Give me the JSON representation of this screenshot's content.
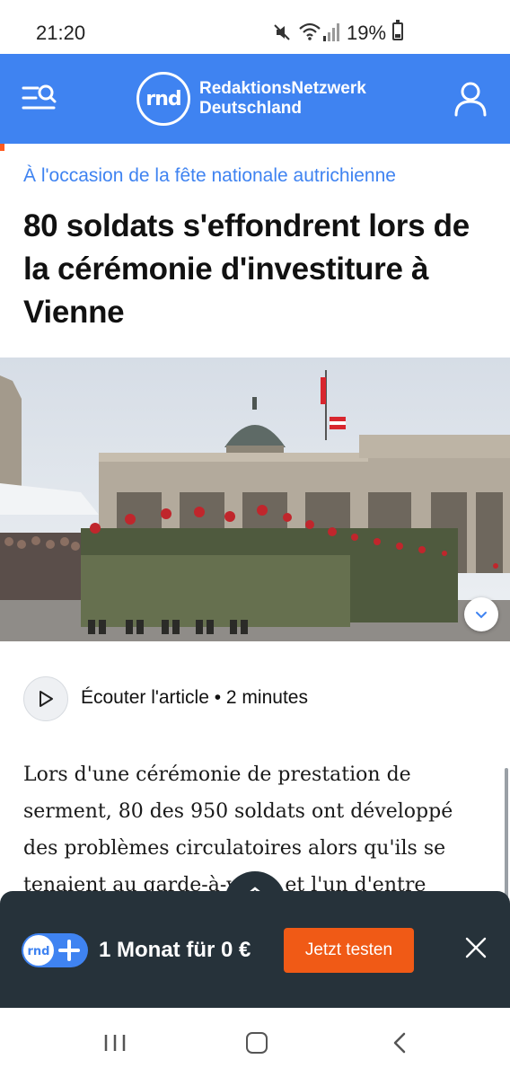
{
  "status_bar": {
    "time": "21:20",
    "battery": "19%",
    "icons": [
      "mute-icon",
      "wifi-icon",
      "signal-icon",
      "battery-icon"
    ]
  },
  "header": {
    "logo_mark": "rnd",
    "brand_line1": "RedaktionsNetzwerk",
    "brand_line2": "Deutschland",
    "accent_color": "#3f83f1",
    "icons": [
      "menu-search-icon",
      "user-icon"
    ]
  },
  "article": {
    "kicker": "À l'occasion de la fête nationale autrichienne",
    "headline": "80 soldats s'effondrent lors de la cérémonie d'investiture à Vienne",
    "audio": {
      "label": "Écouter l'article • 2 minutes"
    },
    "lead": "Lors d'une cérémonie de prestation de serment, 80 des 950 soldats ont développé des problèmes circulatoires alors qu'ils se tenaient au garde-à-vous, et l'un d'entre"
  },
  "promo": {
    "logo_mark": "rnd",
    "text": "1 Monat für 0 €",
    "cta": "Jetzt testen",
    "cta_color": "#f05a16",
    "background": "#26323a"
  },
  "nav_bar": {
    "icons": [
      "recents-icon",
      "home-icon",
      "back-icon"
    ]
  }
}
